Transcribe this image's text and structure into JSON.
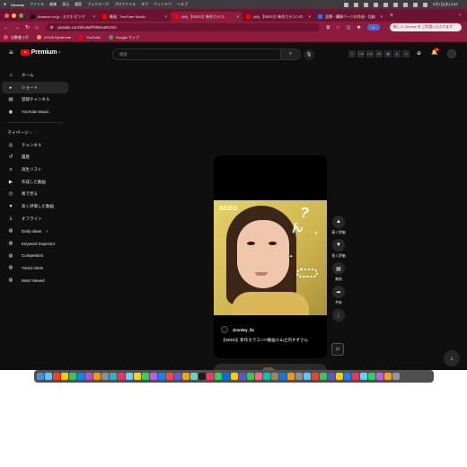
{
  "menubar": {
    "app": "Chrome",
    "items": [
      "ファイル",
      "編集",
      "表示",
      "履歴",
      "ブックマーク",
      "プロファイル",
      "タブ",
      "ウィンドウ",
      "ヘルプ"
    ],
    "clock": "5月1日(木) 8:51"
  },
  "tabs": [
    {
      "title": "Amazon.co.jp : スマホ ピンマ",
      "favicon_color": "#111111"
    },
    {
      "title": "動画 - YouTube Studio",
      "favicon_color": "#ff0000"
    },
    {
      "title": "(46) 【SEED】新作カラコ…",
      "favicon_color": "#ff0000",
      "active": true
    },
    {
      "title": "(46) 【SEED】新作カラコンの",
      "favicon_color": "#ff0000"
    },
    {
      "title": "見積・購買ページの作成・比較",
      "favicon_color": "#3a6fd8"
    }
  ],
  "toolbar": {
    "url": "youtube.com/shorts/PhR6AuRcXn0",
    "update_notice": "新しい Chrome を ご利用いただけます"
  },
  "bookmarks": [
    {
      "label": "自動着ラボ",
      "color": "#e84b6b"
    },
    {
      "label": "DOVA Syndrome",
      "color": "#f5a623"
    },
    {
      "label": "YouTube",
      "color": "#ff0000"
    },
    {
      "label": "Google マップ",
      "color": "#34a853"
    }
  ],
  "header": {
    "logo_text": "Premium",
    "logo_suffix": "JP",
    "search_placeholder": "検索",
    "notifications_count": "9+",
    "extension_labels": [
      "2",
      "1.1K",
      "1.1K",
      "96",
      "+6"
    ]
  },
  "sidebar": {
    "main": [
      {
        "label": "ホーム",
        "icon": "home-icon",
        "glyph": "⌂"
      },
      {
        "label": "ショート",
        "icon": "shorts-icon",
        "glyph": "▸",
        "active": true
      },
      {
        "label": "登録チャンネル",
        "icon": "subscriptions-icon",
        "glyph": "▤"
      },
      {
        "label": "YouTube Music",
        "icon": "music-icon",
        "glyph": "◉"
      }
    ],
    "you_heading": "マイページ ›",
    "you": [
      {
        "label": "チャンネル",
        "icon": "channel-icon",
        "glyph": "◎"
      },
      {
        "label": "履歴",
        "icon": "history-icon",
        "glyph": "↺"
      },
      {
        "label": "再生リスト",
        "icon": "playlist-icon",
        "glyph": "≡"
      },
      {
        "label": "作成した動画",
        "icon": "your-videos-icon",
        "glyph": "▶"
      },
      {
        "label": "後で見る",
        "icon": "watch-later-icon",
        "glyph": "◷"
      },
      {
        "label": "高く評価した動画",
        "icon": "liked-icon",
        "glyph": "♥"
      },
      {
        "label": "オフライン",
        "icon": "download-icon",
        "glyph": "⤓"
      },
      {
        "label": "Daily Ideas",
        "icon": "ideas-icon",
        "glyph": "◍",
        "external": true
      },
      {
        "label": "Keyword Inspector",
        "icon": "keyword-icon",
        "glyph": "◍"
      },
      {
        "label": "Competitors",
        "icon": "competitors-icon",
        "glyph": "◍"
      },
      {
        "label": "Trend Alerts",
        "icon": "trend-icon",
        "glyph": "◍"
      },
      {
        "label": "Most Viewed",
        "icon": "most-viewed-icon",
        "glyph": "◍"
      }
    ]
  },
  "short": {
    "brand_overlay": "SEED",
    "channel": "@ordey_llc",
    "title": "【SEED】新作カラコン!!!動画ル山之内すずさん"
  },
  "actions": [
    {
      "label": "高く評価",
      "icon": "like-icon",
      "glyph": "👍"
    },
    {
      "label": "低く評価",
      "icon": "dislike-icon",
      "glyph": "👎"
    },
    {
      "label": "無効",
      "icon": "comments-icon",
      "glyph": "▤"
    },
    {
      "label": "共有",
      "icon": "share-icon",
      "glyph": "➦"
    }
  ],
  "dock_colors": [
    "#4a90d9",
    "#5ac8fa",
    "#ff3b30",
    "#ffcc00",
    "#34c759",
    "#0a84ff",
    "#af52de",
    "#ff9500",
    "#8e8e93",
    "#30b0c7",
    "#ff2d55",
    "#64d2ff",
    "#ffd60a",
    "#32d74b",
    "#bf5af2",
    "#0a84ff",
    "#ff453a",
    "#5e5ce6",
    "#ff9f0a",
    "#66d4cf",
    "#1c1c1e",
    "#ff375f",
    "#30d158",
    "#0071e3",
    "#ffcc00",
    "#5856d6",
    "#34c759",
    "#ff6482",
    "#00c7be",
    "#a2845e",
    "#007aff",
    "#ff9500",
    "#8e8e93",
    "#5ac8fa",
    "#ff3b30",
    "#34c759",
    "#5856d6",
    "#ffcc00",
    "#0a84ff",
    "#ff2d55",
    "#64d2ff",
    "#30d158",
    "#bf5af2",
    "#ff9f0a",
    "#98989d"
  ]
}
